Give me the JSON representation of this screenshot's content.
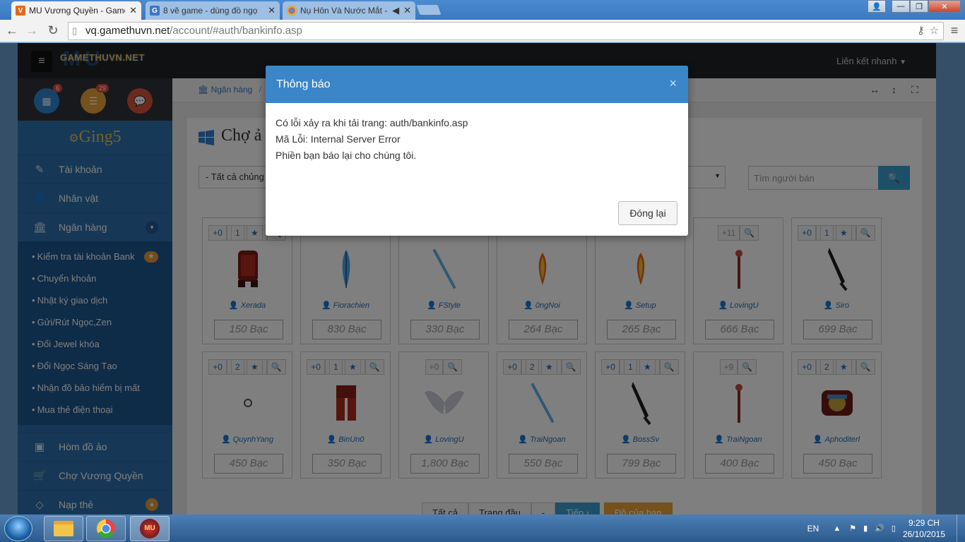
{
  "browser": {
    "tabs": [
      {
        "title": "MU Vương Quyền - Game",
        "favicon": "mu-icon",
        "color": "#e06a1c",
        "active": true
      },
      {
        "title": "8 vẽ game - dùng đồ ngọ",
        "favicon": "g-icon",
        "color": "#3b78c4",
        "active": false
      },
      {
        "title": "Nụ Hôn Và Nước Mắt -",
        "favicon": "chrome-icon",
        "color": "#d33",
        "active": false
      }
    ],
    "url_host": "vq.gamethuvn.net",
    "url_path": "/account/#auth/bankinfo.asp"
  },
  "site": {
    "logo": "GAMETHUVN.NET",
    "logo_bg": "MU",
    "quick_link": "Liên kết nhanh",
    "badge_calendar": "6",
    "badge_list": "29",
    "username": "Ging5"
  },
  "sidebar": {
    "items_top": [
      {
        "label": "Tài khoản",
        "icon": "edit-icon"
      },
      {
        "label": "Nhân vật",
        "icon": "user-icon"
      },
      {
        "label": "Ngân hàng",
        "icon": "bank-icon"
      }
    ],
    "submenu": [
      {
        "label": "Kiểm tra tài khoản Bank",
        "star": true
      },
      {
        "label": "Chuyển khoản",
        "star": false
      },
      {
        "label": "Nhật ký giao dịch",
        "star": false
      },
      {
        "label": "Gửi/Rút Ngọc,Zen",
        "star": false
      },
      {
        "label": "Đổi Jewel khóa",
        "star": false
      },
      {
        "label": "Đổi Ngọc Sáng Tạo",
        "star": false
      },
      {
        "label": "Nhận đồ bảo hiểm bị mất",
        "star": false
      },
      {
        "label": "Mua thẻ điện thoại",
        "star": false
      }
    ],
    "items_bottom": [
      {
        "label": "Hòm đồ ảo",
        "icon": "briefcase-icon"
      },
      {
        "label": "Chợ Vương Quyền",
        "icon": "cart-icon"
      },
      {
        "label": "Nạp thẻ",
        "icon": "diamond-icon"
      }
    ]
  },
  "main": {
    "breadcrumb": "Ngân hàng",
    "breadcrumb_sep": "/",
    "title": "Chợ ả",
    "filter_value": "- Tất cả chủng",
    "search_placeholder": "Tìm người bán",
    "items": [
      {
        "plus": "+0",
        "stars": "1",
        "seller": "Xerada",
        "price": "150 Bạc",
        "img": "armor-red"
      },
      {
        "plus": "",
        "stars": "",
        "seller": "Fiorachien",
        "price": "830 Bạc",
        "img": "feather-blue"
      },
      {
        "plus": "",
        "stars": "",
        "seller": "FStyle",
        "price": "330 Bạc",
        "img": "staff-blue"
      },
      {
        "plus": "",
        "stars": "",
        "seller": "0ngNoi",
        "price": "264 Bạc",
        "img": "feather-fire"
      },
      {
        "plus": "",
        "stars": "",
        "seller": "Setup",
        "price": "265 Bạc",
        "img": "feather-fire"
      },
      {
        "plus": "+11",
        "stars": "",
        "seller": "LovingU",
        "price": "666 Bạc",
        "img": "staff-red"
      },
      {
        "plus": "+0",
        "stars": "1",
        "seller": "Siro",
        "price": "699 Bạc",
        "img": "sword-dark"
      },
      {
        "plus": "+0",
        "stars": "2",
        "seller": "QuynhYang",
        "price": "450 Bạc",
        "img": "ring"
      },
      {
        "plus": "+0",
        "stars": "1",
        "seller": "BinUn0",
        "price": "350 Bạc",
        "img": "pants-red"
      },
      {
        "plus": "+0",
        "stars": "",
        "seller": "LovingU",
        "price": "1,800 Bạc",
        "img": "wings"
      },
      {
        "plus": "+0",
        "stars": "2",
        "seller": "TraiNgoan",
        "price": "550 Bạc",
        "img": "staff-blue"
      },
      {
        "plus": "+0",
        "stars": "1",
        "seller": "BossSv",
        "price": "799 Bạc",
        "img": "sword-dark"
      },
      {
        "plus": "+9",
        "stars": "",
        "seller": "TraiNgoan",
        "price": "400 Bạc",
        "img": "staff-red"
      },
      {
        "plus": "+0",
        "stars": "2",
        "seller": "Aphoditerl",
        "price": "450 Bạc",
        "img": "armor-ornate"
      }
    ],
    "pager": {
      "all": "Tất cả",
      "first": "Trang đầu",
      "dash": "-",
      "next": "Tiếp",
      "yours": "Đồ của bạn"
    }
  },
  "modal": {
    "title": "Thông báo",
    "close": "×",
    "line1": "Có lỗi xảy ra khi tải trang: auth/bankinfo.asp",
    "line2": "Mã Lỗi: Internal Server Error",
    "line3": "Phiền bạn báo lại cho chúng tôi.",
    "ok": "Đóng lại"
  },
  "taskbar": {
    "lang": "EN",
    "time": "9:29 CH",
    "date": "26/10/2015"
  }
}
